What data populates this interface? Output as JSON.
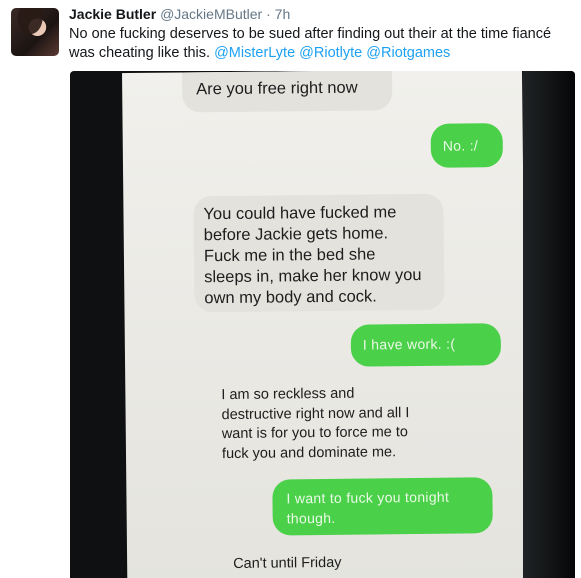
{
  "tweet": {
    "author_name": "Jackie Butler",
    "author_handle": "@JackieMButler",
    "separator": "·",
    "time": "7h",
    "text": "No one fucking deserves to be sued after finding out their at the time fiancé was cheating like this.",
    "mentions": [
      "@MisterLyte",
      "@Riotlyte",
      "@Riotgames"
    ],
    "colors": {
      "name": "#14171a",
      "meta": "#657786",
      "link": "#1da1f2"
    }
  },
  "photo": {
    "messages": [
      {
        "side": "incoming",
        "text": "Are you free right now"
      },
      {
        "side": "outgoing",
        "text": "No. :/"
      },
      {
        "side": "incoming",
        "lines": [
          "You could have fucked me",
          "before Jackie gets home.",
          "Fuck me in the bed she",
          "sleeps in, make her know you",
          "own my body and cock."
        ]
      },
      {
        "side": "outgoing",
        "text": "I have work. :("
      },
      {
        "side": "incoming",
        "lines": [
          "I am so reckless and",
          "destructive right now and all I",
          "want is for you to force me to",
          "fuck you and dominate me."
        ]
      },
      {
        "side": "outgoing",
        "lines": [
          "I want to fuck you tonight",
          "though."
        ]
      },
      {
        "side": "incoming",
        "text": "Can't until Friday"
      }
    ],
    "colors": {
      "incoming_bubble": "#e3e2dd",
      "outgoing_bubble": "#4bd04a"
    }
  }
}
